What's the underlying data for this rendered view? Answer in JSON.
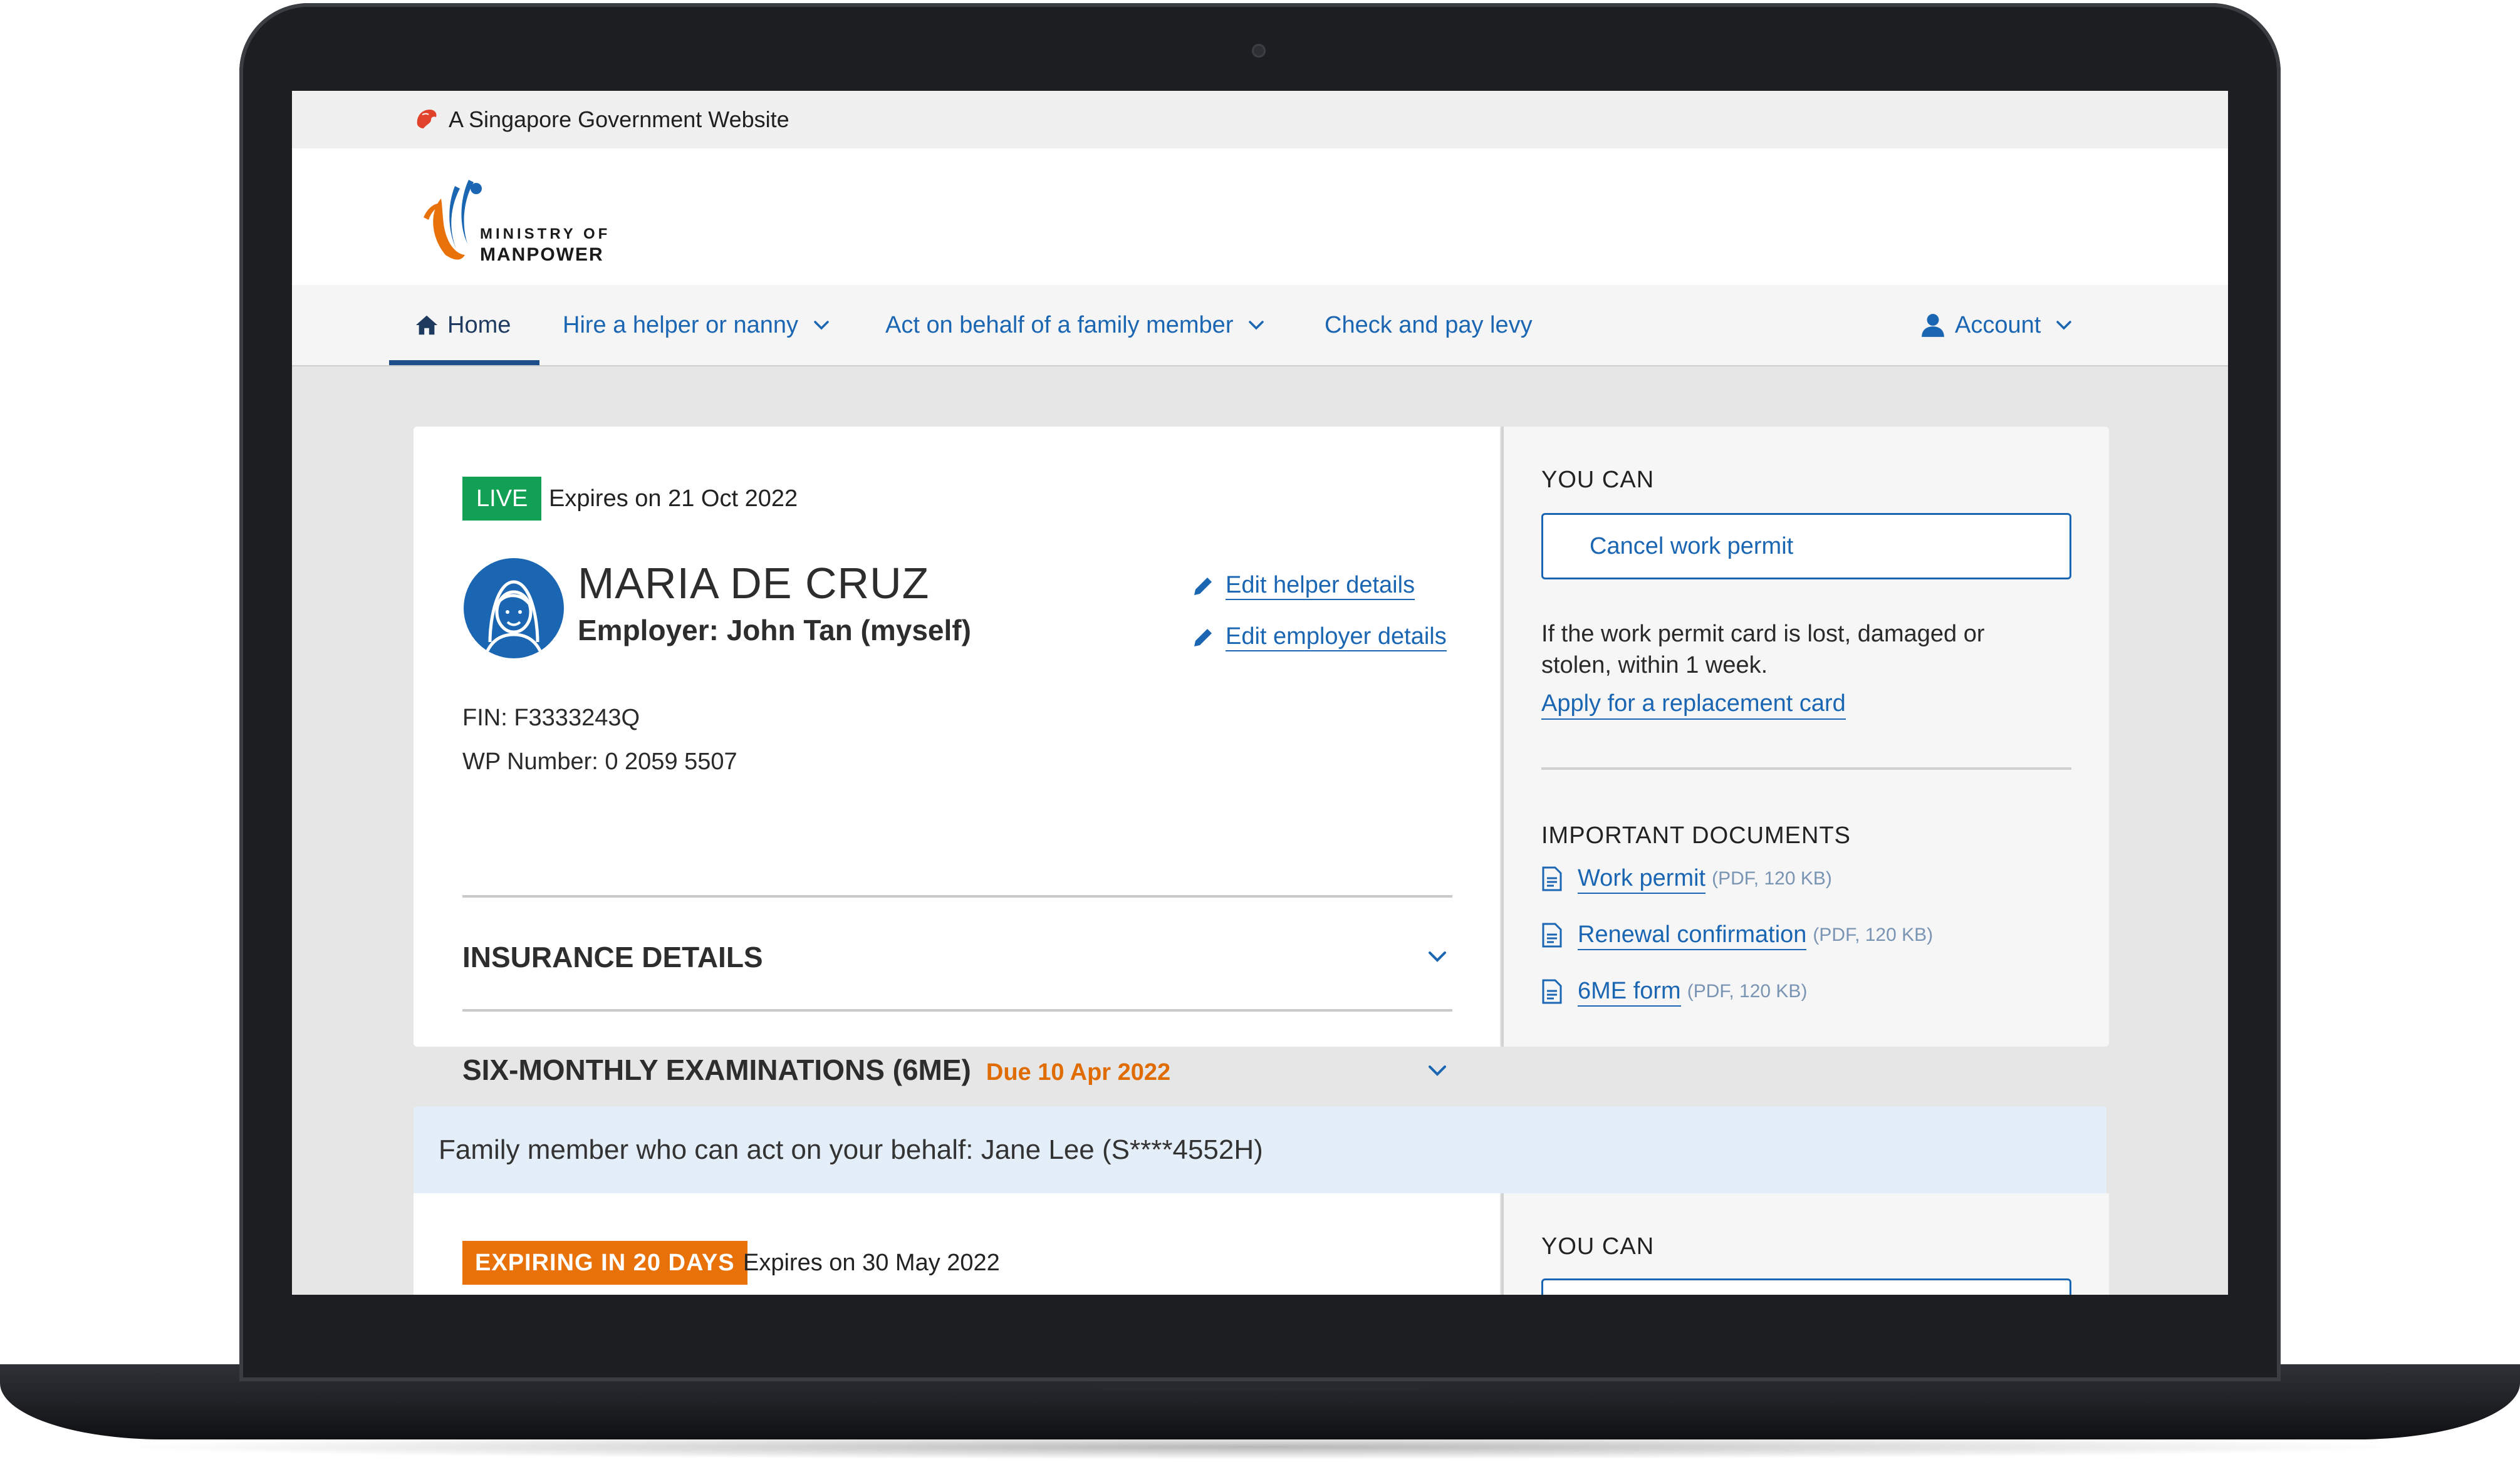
{
  "masthead": {
    "text": "A Singapore Government Website"
  },
  "logo": {
    "line1": "MINISTRY OF",
    "line2": "MANPOWER"
  },
  "nav": {
    "home": "Home",
    "hire": "Hire a helper or nanny",
    "act": "Act on behalf of a family member",
    "levy": "Check and pay levy",
    "account": "Account"
  },
  "permit1": {
    "status": "LIVE",
    "expiry": "Expires on 21 Oct 2022",
    "name": "MARIA DE CRUZ",
    "employer": "Employer: John Tan (myself)",
    "edit_helper": "Edit helper details",
    "edit_employer": "Edit employer details",
    "fin": "FIN: F3333243Q",
    "wp": "WP Number: 0 2059 5507",
    "insurance": "INSURANCE DETAILS",
    "exam": "SIX-MONTHLY EXAMINATIONS (6ME)",
    "exam_due": "Due 10 Apr 2022"
  },
  "side1": {
    "you_can": "YOU CAN",
    "cancel": "Cancel work permit",
    "lost_text": "If the work permit card is lost, damaged or stolen, within 1 week.",
    "replacement": "Apply for a replacement card",
    "docs_title": "IMPORTANT DOCUMENTS",
    "docs": [
      {
        "label": "Work permit",
        "meta": "(PDF, 120 KB)"
      },
      {
        "label": "Renewal confirmation",
        "meta": "(PDF, 120 KB)"
      },
      {
        "label": "6ME form",
        "meta": "(PDF, 120 KB)"
      }
    ]
  },
  "family": {
    "text": "Family member who can act on your behalf: Jane Lee (S****4552H)"
  },
  "permit2": {
    "status": "EXPIRING IN 20 DAYS",
    "expiry": "Expires on 30 May 2022",
    "you_can": "YOU CAN"
  },
  "colors": {
    "primary": "#1b66b3",
    "live": "#12a055",
    "warning": "#e8710a",
    "banner": "#e4eef9"
  },
  "icons": [
    "lion-head-icon",
    "mom-logo",
    "home-icon",
    "chevron-down-icon",
    "user-icon",
    "helper-avatar-icon",
    "pencil-icon",
    "document-icon"
  ]
}
